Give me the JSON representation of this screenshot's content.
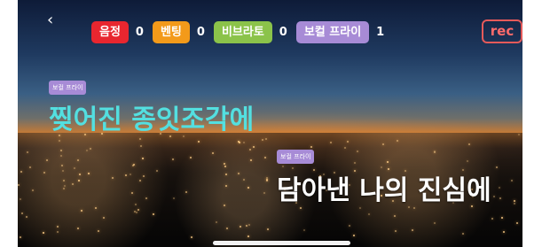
{
  "nav": {
    "back_icon": "chevron-left-icon",
    "back_glyph": "‹"
  },
  "counters": [
    {
      "label": "음정",
      "value": "0",
      "color": "#e8262f"
    },
    {
      "label": "벤팅",
      "value": "0",
      "color": "#f39a1a"
    },
    {
      "label": "비브라토",
      "value": "0",
      "color": "#8bc34a"
    },
    {
      "label": "보컬 프라이",
      "value": "1",
      "color": "#a78bd6"
    }
  ],
  "rec_button": {
    "label": "rec",
    "color": "#e55a5a"
  },
  "lyrics": [
    {
      "badge": "보컬 프라이",
      "text": "찢어진 종잇조각에",
      "color": "#53dfe0"
    },
    {
      "badge": "보컬 프라이",
      "text": "담아낸 나의 진심에",
      "color": "#ffffff"
    }
  ]
}
